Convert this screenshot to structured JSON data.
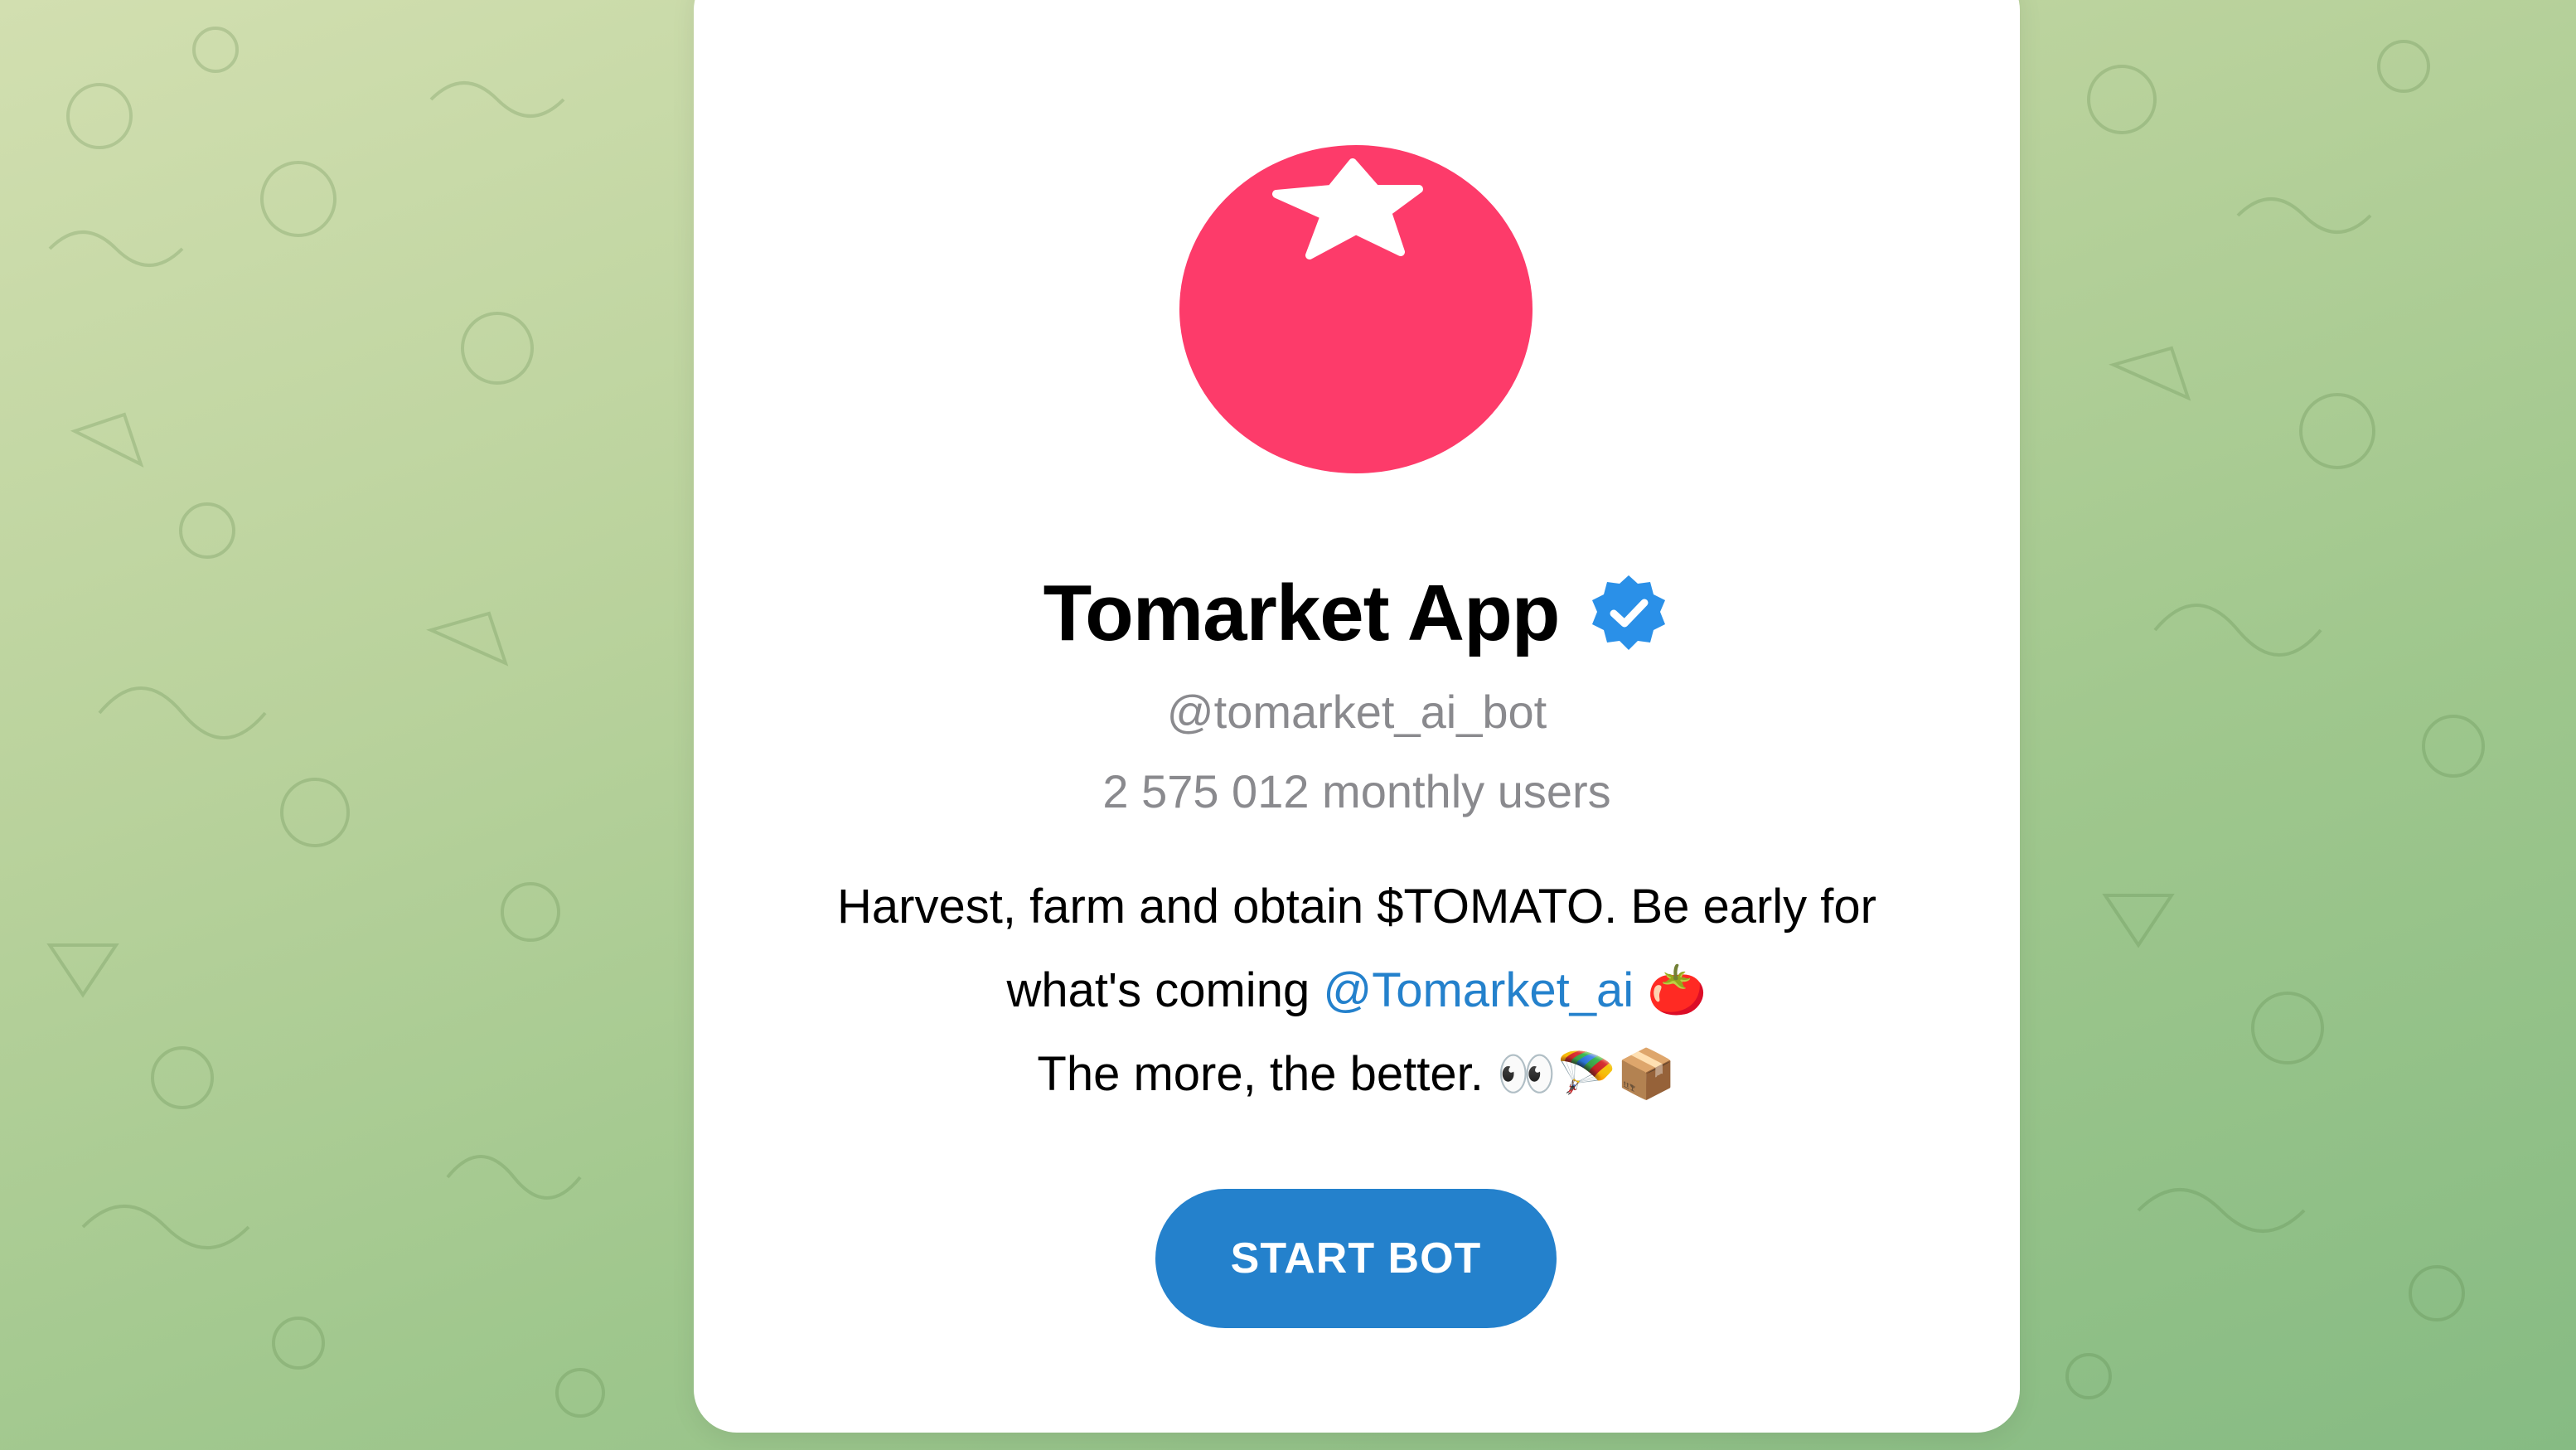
{
  "bot": {
    "title": "Tomarket App",
    "username": "@tomarket_ai_bot",
    "monthly_users": "2 575 012 monthly users",
    "description": {
      "line1": "Harvest, farm and obtain $TOMATO. Be early for",
      "line2_prefix": "what's coming ",
      "line2_link": "@Tomarket_ai",
      "line2_emoji": "🍅",
      "line3_text": "The more, the better. ",
      "line3_emoji": "👀🪂📦"
    },
    "start_button_label": "START BOT",
    "verified_icon": "verified-badge-icon",
    "avatar_icon": "tomato-logo"
  },
  "colors": {
    "accent": "#2481cc",
    "tomato": "#fd3b6a",
    "secondary_text": "#8a8a8e",
    "background_green": "#a9cc8f"
  }
}
